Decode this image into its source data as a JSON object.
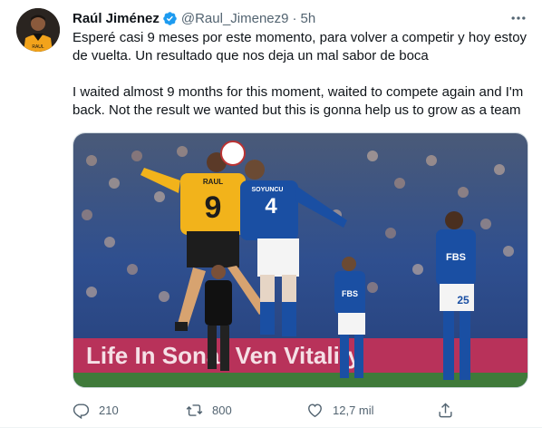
{
  "user": {
    "display_name": "Raúl Jiménez",
    "handle": "@Raul_Jimenez9",
    "separator": "·",
    "time": "5h"
  },
  "tweet": {
    "text_es": "Esperé casi 9 meses por este momento, para volver a competir y hoy estoy de vuelta. Un resultado que nos deja un mal sabor de boca",
    "text_en": "I waited almost 9 months for this moment, waited to compete again and I'm back. Not the result we wanted but this is gonna help us to grow as a team"
  },
  "media": {
    "shirt_number_wolves": "9",
    "shirt_name_wolves": "RAUL",
    "shirt_number_leicester": "4",
    "shirt_name_leicester": "SOYUNCU",
    "sponsor_leicester": "FBS",
    "shirt_number_player_right": "25",
    "ad_board_text": "Life In Sonar Ven Vitality"
  },
  "actions": {
    "replies": "210",
    "retweets": "800",
    "likes": "12,7 mil"
  },
  "colors": {
    "text": "#0f1419",
    "secondary": "#536471",
    "verified": "#1d9bf0",
    "wolves_gold": "#f2b31b",
    "leicester_blue": "#1a4fa3"
  },
  "icons": [
    "verified-badge-icon",
    "more-options-icon",
    "reply-icon",
    "retweet-icon",
    "like-icon",
    "share-icon"
  ]
}
